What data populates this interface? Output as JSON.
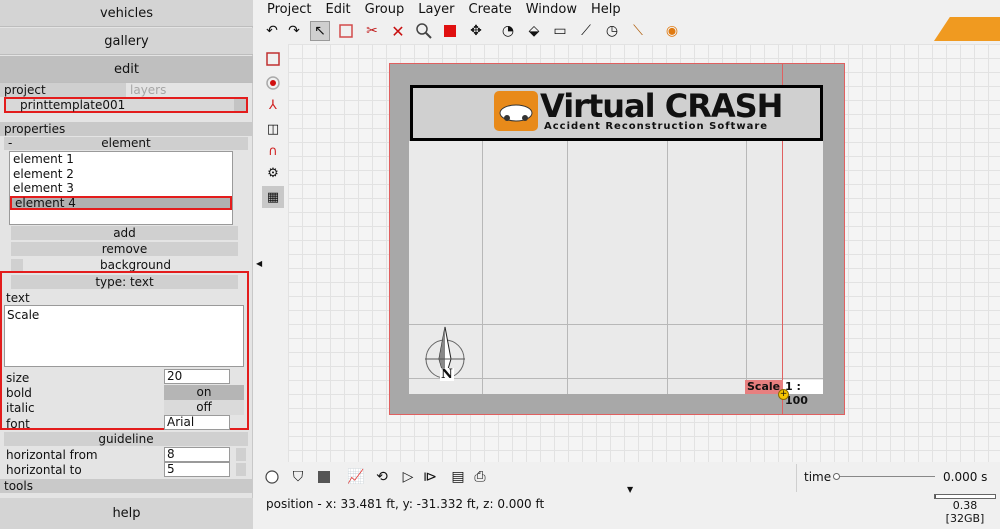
{
  "nav": {
    "vehicles": "vehicles",
    "gallery": "gallery",
    "edit": "edit",
    "help": "help"
  },
  "tabs": {
    "project": "project",
    "layers": "layers"
  },
  "project": {
    "name": "printtemplate001"
  },
  "sections": {
    "properties": "properties",
    "tools": "tools"
  },
  "element": {
    "header": "element",
    "collapse": "-",
    "items": [
      "element 1",
      "element 2",
      "element 3",
      "element 4"
    ],
    "selected_index": 3,
    "add": "add",
    "remove": "remove",
    "background": "background",
    "type": "type: text"
  },
  "text_props": {
    "text_label": "text",
    "text_value": "Scale",
    "size_label": "size",
    "size_value": "20",
    "bold_label": "bold",
    "bold_value": "on",
    "italic_label": "italic",
    "italic_value": "off",
    "font_label": "font",
    "font_value": "Arial"
  },
  "guideline": {
    "header": "guideline",
    "horizontal_from_label": "horizontal from",
    "horizontal_from_value": "8",
    "horizontal_to_label": "horizontal to",
    "horizontal_to_value": "5"
  },
  "menu": [
    "Project",
    "Edit",
    "Group",
    "Layer",
    "Create",
    "Window",
    "Help"
  ],
  "canvas": {
    "banner_title": "Virtual CRASH",
    "banner_subtitle": "Accident Reconstruction Software",
    "compass_letter": "N",
    "scale_label": "Scale",
    "scale_ratio": "1 : 100"
  },
  "time": {
    "label": "time",
    "value": "0.000 s"
  },
  "status": {
    "position": "position - x: 33.481 ft, y: -31.332 ft, z: 0.000 ft"
  },
  "memory": {
    "value": "0.38",
    "total": "[32GB]"
  },
  "colors": {
    "accent_red": "#e31c1c",
    "brand_orange": "#f09a20"
  }
}
